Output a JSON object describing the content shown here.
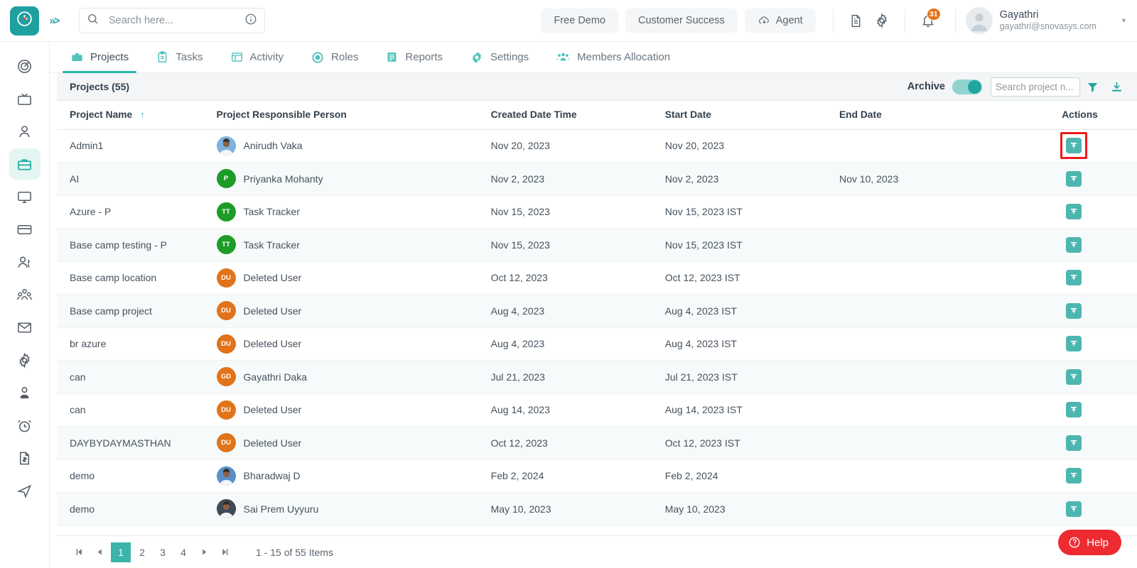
{
  "brand": {
    "accent": "#21a79d",
    "logo_icon": "clock-icon",
    "expand_icon": "double-chevron-right-icon"
  },
  "topbar": {
    "search": {
      "placeholder": "Search here...",
      "value": "",
      "search_icon": "search-icon",
      "info_icon": "info-circle-icon"
    },
    "buttons": [
      {
        "label": "Free Demo",
        "name": "free-demo-button",
        "icon": null
      },
      {
        "label": "Customer Success",
        "name": "customer-success-button",
        "icon": null
      },
      {
        "label": "Agent",
        "name": "agent-button",
        "icon": "cloud-download-icon"
      }
    ],
    "icons": [
      {
        "name": "document-icon"
      },
      {
        "name": "gear-icon"
      }
    ],
    "notifications": {
      "icon": "bell-icon",
      "count": "31",
      "badge_color": "#e8711a"
    },
    "profile": {
      "name": "Gayathri",
      "email": "gayathri@snovasys.com",
      "avatar_icon": "user-avatar-icon",
      "caret": "▾"
    }
  },
  "sidebar": {
    "items": [
      {
        "icon": "target-icon",
        "active": false
      },
      {
        "icon": "tv-icon",
        "active": false
      },
      {
        "icon": "person-icon",
        "active": false
      },
      {
        "icon": "briefcase-icon",
        "active": true
      },
      {
        "icon": "monitor-icon",
        "active": false
      },
      {
        "icon": "credit-card-icon",
        "active": false
      },
      {
        "icon": "users-icon",
        "active": false
      },
      {
        "icon": "group-people-icon",
        "active": false
      },
      {
        "icon": "mail-icon",
        "active": false
      },
      {
        "icon": "settings-gear-icon",
        "active": false
      },
      {
        "icon": "user-badge-icon",
        "active": false
      },
      {
        "icon": "alarm-clock-icon",
        "active": false
      },
      {
        "icon": "invoice-dollar-icon",
        "active": false
      },
      {
        "icon": "send-plane-icon",
        "active": false
      }
    ]
  },
  "tabs": [
    {
      "label": "Projects",
      "icon": "briefcase-icon",
      "active": true
    },
    {
      "label": "Tasks",
      "icon": "clipboard-icon",
      "active": false
    },
    {
      "label": "Activity",
      "icon": "list-grid-icon",
      "active": false
    },
    {
      "label": "Roles",
      "icon": "target-gear-icon",
      "active": false
    },
    {
      "label": "Reports",
      "icon": "report-lines-icon",
      "active": false
    },
    {
      "label": "Settings",
      "icon": "gear-icon",
      "active": false
    },
    {
      "label": "Members Allocation",
      "icon": "people-group-icon",
      "active": false
    }
  ],
  "panel": {
    "title": "Projects (55)",
    "archive_label": "Archive",
    "archive_on": true,
    "project_search": {
      "placeholder": "Search project n...",
      "value": ""
    },
    "filter_icon": "filter-funnel-icon",
    "download_icon": "download-icon"
  },
  "table": {
    "columns": [
      {
        "label": "Project Name",
        "sorted": "asc",
        "sort_glyph": "↑"
      },
      {
        "label": "Project Responsible Person"
      },
      {
        "label": "Created Date Time"
      },
      {
        "label": "Start Date"
      },
      {
        "label": "End Date"
      },
      {
        "label": "Actions"
      }
    ],
    "rows": [
      {
        "name": "Admin1",
        "person": "Anirudh Vaka",
        "initials": "",
        "avatar_type": "photo",
        "avatar_color": "#7fb2e0",
        "created": "Nov 20, 2023",
        "start": "Nov 20, 2023",
        "end": "",
        "action_icon": "unarchive-icon",
        "highlighted": true
      },
      {
        "name": "AI",
        "person": "Priyanka Mohanty",
        "initials": "P",
        "avatar_type": "initials",
        "avatar_color": "#1d9c27",
        "created": "Nov 2, 2023",
        "start": "Nov 2, 2023",
        "end": "Nov 10, 2023",
        "action_icon": "unarchive-icon",
        "highlighted": false
      },
      {
        "name": "Azure - P",
        "person": "Task Tracker",
        "initials": "TT",
        "avatar_type": "initials",
        "avatar_color": "#1d9c27",
        "created": "Nov 15, 2023",
        "start": "Nov 15, 2023 IST",
        "end": "",
        "action_icon": "unarchive-icon",
        "highlighted": false
      },
      {
        "name": "Base camp testing - P",
        "person": "Task Tracker",
        "initials": "TT",
        "avatar_type": "initials",
        "avatar_color": "#1d9c27",
        "created": "Nov 15, 2023",
        "start": "Nov 15, 2023 IST",
        "end": "",
        "action_icon": "unarchive-icon",
        "highlighted": false
      },
      {
        "name": "Base camp location",
        "person": "Deleted User",
        "initials": "DU",
        "avatar_type": "initials",
        "avatar_color": "#e1731a",
        "created": "Oct 12, 2023",
        "start": "Oct 12, 2023 IST",
        "end": "",
        "action_icon": "unarchive-icon",
        "highlighted": false
      },
      {
        "name": "Base camp project",
        "person": "Deleted User",
        "initials": "DU",
        "avatar_type": "initials",
        "avatar_color": "#e1731a",
        "created": "Aug 4, 2023",
        "start": "Aug 4, 2023 IST",
        "end": "",
        "action_icon": "unarchive-icon",
        "highlighted": false
      },
      {
        "name": "br azure",
        "person": "Deleted User",
        "initials": "DU",
        "avatar_type": "initials",
        "avatar_color": "#e1731a",
        "created": "Aug 4, 2023",
        "start": "Aug 4, 2023 IST",
        "end": "",
        "action_icon": "unarchive-icon",
        "highlighted": false
      },
      {
        "name": "can",
        "person": "Gayathri Daka",
        "initials": "GD",
        "avatar_type": "initials",
        "avatar_color": "#e1731a",
        "created": "Jul 21, 2023",
        "start": "Jul 21, 2023 IST",
        "end": "",
        "action_icon": "unarchive-icon",
        "highlighted": false
      },
      {
        "name": "can",
        "person": "Deleted User",
        "initials": "DU",
        "avatar_type": "initials",
        "avatar_color": "#e1731a",
        "created": "Aug 14, 2023",
        "start": "Aug 14, 2023 IST",
        "end": "",
        "action_icon": "unarchive-icon",
        "highlighted": false
      },
      {
        "name": "DAYBYDAYMASTHAN",
        "person": "Deleted User",
        "initials": "DU",
        "avatar_type": "initials",
        "avatar_color": "#e1731a",
        "created": "Oct 12, 2023",
        "start": "Oct 12, 2023 IST",
        "end": "",
        "action_icon": "unarchive-icon",
        "highlighted": false
      },
      {
        "name": "demo",
        "person": "Bharadwaj D",
        "initials": "",
        "avatar_type": "photo",
        "avatar_color": "#5b8fc9",
        "created": "Feb 2, 2024",
        "start": "Feb 2, 2024",
        "end": "",
        "action_icon": "unarchive-icon",
        "highlighted": false
      },
      {
        "name": "demo",
        "person": "Sai Prem Uyyuru",
        "initials": "",
        "avatar_type": "photo",
        "avatar_color": "#3f4a57",
        "created": "May 10, 2023",
        "start": "May 10, 2023",
        "end": "",
        "action_icon": "unarchive-icon",
        "highlighted": false
      }
    ]
  },
  "pagination": {
    "first_glyph": "⏮",
    "prev_glyph": "◀",
    "next_glyph": "▶",
    "last_glyph": "⏭",
    "pages": [
      "1",
      "2",
      "3",
      "4"
    ],
    "current": "1",
    "info": "1 - 15 of 55 Items"
  },
  "help": {
    "label": "Help",
    "icon": "question-circle-icon",
    "color": "#ed2b31"
  }
}
